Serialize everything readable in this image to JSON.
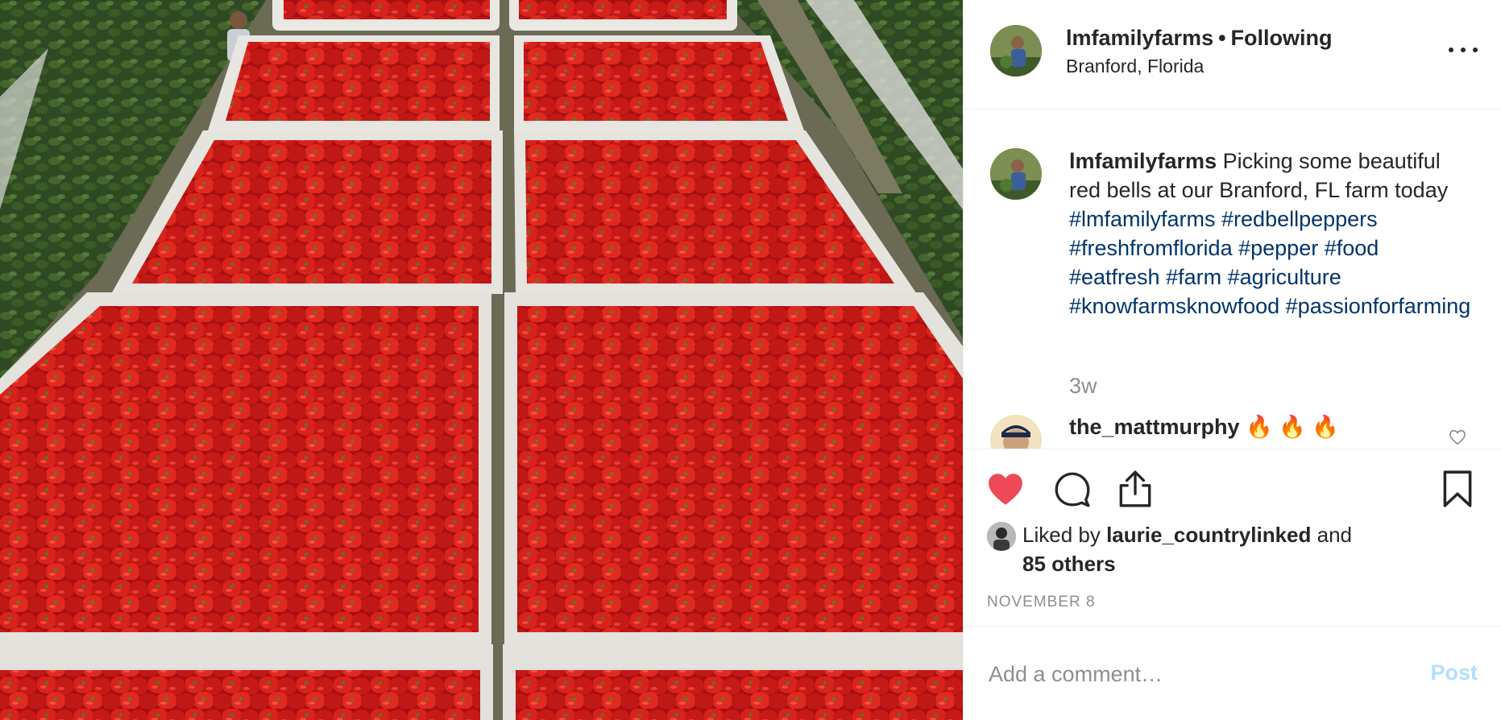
{
  "post": {
    "photo_alt": "",
    "header": {
      "username": "lmfamilyfarms",
      "separator": "•",
      "follow_status": "Following",
      "location": "Branford, Florida",
      "more_icon": "more-horizontal-icon"
    },
    "caption": {
      "author": "lmfamilyfarms",
      "text": "Picking some beautiful red bells at our Branford, FL farm today",
      "hashtags": [
        "#lmfamilyfarms",
        "#redbellpeppers",
        "#freshfromflorida",
        "#pepper",
        "#food",
        "#eatfresh",
        "#farm",
        "#agriculture",
        "#knowfarmsknowfood",
        "#passionforfarming"
      ],
      "relative_time": "3w"
    },
    "comments": [
      {
        "author": "the_mattmurphy",
        "text": "🔥 🔥 🔥"
      }
    ],
    "actions": {
      "like_icon": "heart-filled-icon",
      "comment_icon": "comment-bubble-icon",
      "share_icon": "share-upload-icon",
      "save_icon": "bookmark-icon",
      "like_color": "#ed4956"
    },
    "likes": {
      "prefix": "Liked by",
      "liker": "laurie_countrylinked",
      "conjunction": "and",
      "others": "85 others"
    },
    "date": "NOVEMBER 8",
    "add_comment": {
      "placeholder": "Add a comment…",
      "post_label": "Post",
      "post_color": "#b2dffc"
    }
  }
}
